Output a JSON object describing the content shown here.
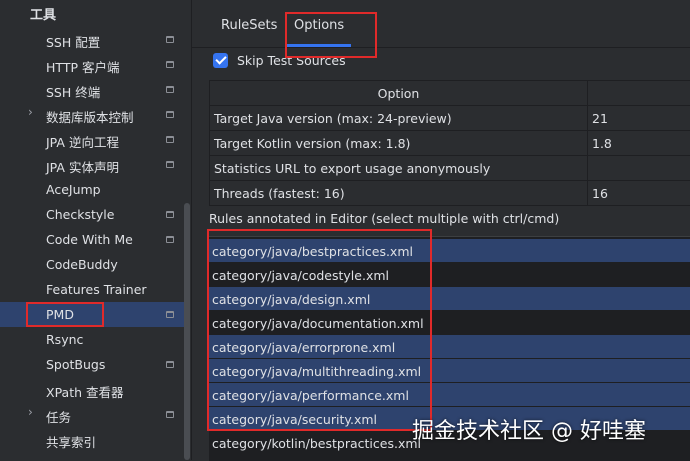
{
  "sidebar": {
    "header": "工具",
    "items": [
      {
        "label": "SSH 配置",
        "icon": "page-icon",
        "expandable": false
      },
      {
        "label": "HTTP 客户端",
        "icon": "page-icon",
        "expandable": false
      },
      {
        "label": "SSH 终端",
        "icon": "page-icon",
        "expandable": false
      },
      {
        "label": "数据库版本控制",
        "icon": "page-icon",
        "expandable": true
      },
      {
        "label": "JPA 逆向工程",
        "icon": "page-icon",
        "expandable": false
      },
      {
        "label": "JPA 实体声明",
        "icon": "page-icon",
        "expandable": false
      },
      {
        "label": "AceJump",
        "icon": "",
        "expandable": false
      },
      {
        "label": "Checkstyle",
        "icon": "page-icon",
        "expandable": false
      },
      {
        "label": "Code With Me",
        "icon": "page-icon",
        "expandable": false
      },
      {
        "label": "CodeBuddy",
        "icon": "",
        "expandable": false
      },
      {
        "label": "Features Trainer",
        "icon": "",
        "expandable": false
      },
      {
        "label": "PMD",
        "icon": "page-icon",
        "expandable": false,
        "selected": true
      },
      {
        "label": "Rsync",
        "icon": "",
        "expandable": false
      },
      {
        "label": "SpotBugs",
        "icon": "page-icon",
        "expandable": false
      },
      {
        "label": "XPath 查看器",
        "icon": "",
        "expandable": false
      },
      {
        "label": "任务",
        "icon": "page-icon",
        "expandable": true
      },
      {
        "label": "共享索引",
        "icon": "",
        "expandable": false
      }
    ]
  },
  "tabs": [
    {
      "label": "RuleSets",
      "active": false
    },
    {
      "label": "Options",
      "active": true
    }
  ],
  "skip_test_sources": {
    "label": "Skip Test Sources",
    "checked": true
  },
  "options_table": {
    "header": "Option",
    "rows": [
      {
        "option": "Target Java version (max: 24-preview)",
        "value": "21"
      },
      {
        "option": "Target Kotlin version (max: 1.8)",
        "value": "1.8"
      },
      {
        "option": "Statistics URL to export usage anonymously",
        "value": ""
      },
      {
        "option": "Threads (fastest: 16)",
        "value": "16"
      }
    ]
  },
  "rules_title": "Rules annotated in Editor (select multiple with ctrl/cmd)",
  "rules": [
    {
      "label": "category/java/bestpractices.xml",
      "selected": true
    },
    {
      "label": "category/java/codestyle.xml",
      "selected": false
    },
    {
      "label": "category/java/design.xml",
      "selected": true
    },
    {
      "label": "category/java/documentation.xml",
      "selected": false
    },
    {
      "label": "category/java/errorprone.xml",
      "selected": true
    },
    {
      "label": "category/java/multithreading.xml",
      "selected": true
    },
    {
      "label": "category/java/performance.xml",
      "selected": true
    },
    {
      "label": "category/java/security.xml",
      "selected": true
    },
    {
      "label": "category/kotlin/bestpractices.xml",
      "selected": false
    }
  ],
  "watermark": "掘金技术社区 @ 好哇塞",
  "colors": {
    "background": "#2b2d30",
    "accent": "#3574f0",
    "selection": "#2e436e",
    "annotation": "#e02a2a"
  }
}
